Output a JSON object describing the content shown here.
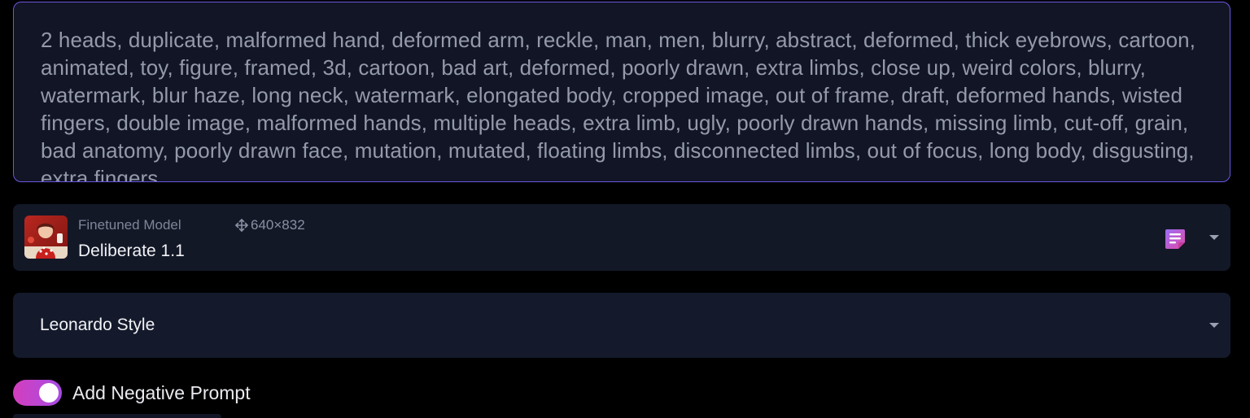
{
  "prompt": {
    "value": "2 heads, duplicate, malformed hand, deformed arm, reckle, man, men, blurry, abstract, deformed, thick eyebrows, cartoon, animated, toy, figure, framed, 3d, cartoon, bad art, deformed, poorly drawn, extra limbs, close up, weird colors, blurry, watermark, blur haze, long neck, watermark, elongated body, cropped image, out of frame, draft, deformed hands, wisted fingers, double image, malformed hands, multiple heads, extra limb, ugly, poorly drawn hands, missing limb, cut-off, grain, bad anatomy, poorly drawn face, mutation, mutated, floating limbs, disconnected limbs, out of focus, long body, disgusting, extra fingers,"
  },
  "model": {
    "caption": "Finetuned Model",
    "dimensions": "640×832",
    "name": "Deliberate 1.1",
    "thumbnail_icon": "model-thumbnail-image",
    "notes_icon": "notes-icon",
    "dropdown_icon": "chevron-down-icon"
  },
  "style": {
    "selected": "Leonardo Style",
    "dropdown_icon": "chevron-down-icon"
  },
  "negative_prompt_toggle": {
    "label": "Add Negative Prompt",
    "enabled": true
  },
  "colors": {
    "background": "#000000",
    "panel": "#131827",
    "focus_border": "#6b56e0",
    "toggle_gradient_start": "#d33fbd",
    "toggle_gradient_end": "#a74be4"
  }
}
